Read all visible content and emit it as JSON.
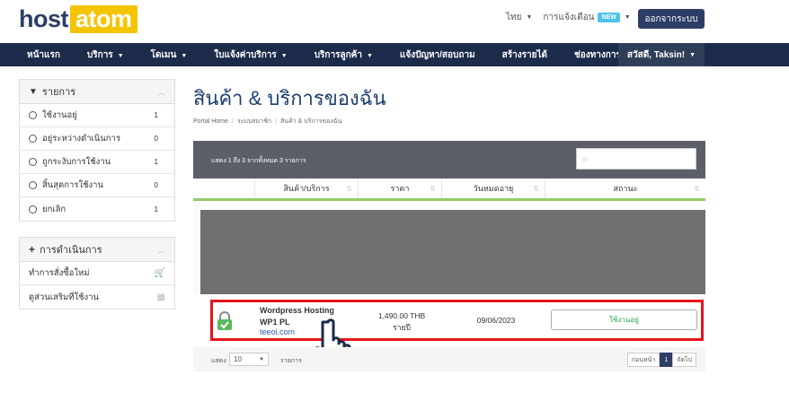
{
  "logo": {
    "part1": "host",
    "part2": "atom"
  },
  "top": {
    "lang": "ไทย",
    "notify": "การแจ้งเตือน",
    "new_badge": "NEW",
    "logout": "ออกจากระบบ"
  },
  "nav": {
    "items": [
      "หน้าแรก",
      "บริการ",
      "โดเมน",
      "ใบแจ้งค่าบริการ",
      "บริการลูกค้า",
      "แจ้งปัญหา/สอบถาม",
      "สร้างรายได้",
      "ช่องทางการชำระเงิน"
    ],
    "user": "สวัสดี, Taksin!"
  },
  "sidebar": {
    "filter_title": "รายการ",
    "filters": [
      {
        "label": "ใช้งานอยู่",
        "count": "1"
      },
      {
        "label": "อยู่ระหว่างดำเนินการ",
        "count": "0"
      },
      {
        "label": "ถูกระงับการใช้งาน",
        "count": "1"
      },
      {
        "label": "สิ้นสุดการใช้งาน",
        "count": "0"
      },
      {
        "label": "ยกเลิก",
        "count": "1"
      }
    ],
    "actions_title": "การดำเนินการ",
    "actions": [
      {
        "label": "ทำการสั่งซื้อใหม่",
        "icon": "cart-icon"
      },
      {
        "label": "ดูส่วนเสริมที่ใช้งาน",
        "icon": "cubes-icon"
      }
    ]
  },
  "page": {
    "title": "สินค้า & บริการของฉัน",
    "breadcrumb": [
      "Portal Home",
      "ระบบสมาชิก",
      "สินค้า & บริการของฉัน"
    ]
  },
  "table": {
    "info": "แสดง 1 ถึง 3 จากทั้งหมด 3 รายการ",
    "columns": [
      "สินค้า/บริการ",
      "ราคา",
      "วันหมดอายุ",
      "สถานะ"
    ],
    "row": {
      "name1": "Wordpress Hosting",
      "name2": "WP1 PL",
      "domain": "teeoi.com",
      "price": "1,490.00 THB",
      "cycle": "รายปี",
      "due": "09/06/2023",
      "status": "ใช้งานอยู่"
    },
    "show_label": "แสดง",
    "show_value": "10",
    "show_suffix": "รายการ",
    "prev": "ก่อนหน้า",
    "page": "1",
    "next": "ถัดไป"
  },
  "colors": {
    "brand_navy": "#1c2b4a",
    "accent_yellow": "#f5c400",
    "status_green": "#2aa84a",
    "highlight_red": "#e8141c"
  }
}
